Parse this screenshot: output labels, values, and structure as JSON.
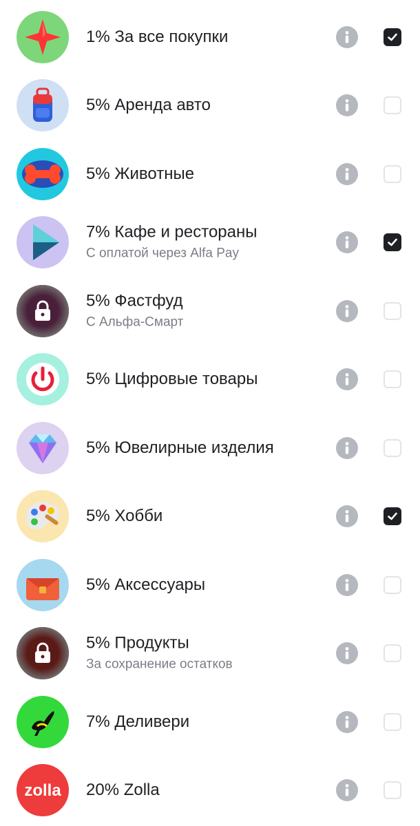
{
  "categories": [
    {
      "title": "1% За все покупки",
      "subtitle": "",
      "checked": true,
      "icon": "red-star-icon",
      "bg": "#7ed67a"
    },
    {
      "title": "5% Аренда авто",
      "subtitle": "",
      "checked": false,
      "icon": "backpack-icon",
      "bg": "#cfe0f5"
    },
    {
      "title": "5% Животные",
      "subtitle": "",
      "checked": false,
      "icon": "bone-icon",
      "bg": "#22c8e0"
    },
    {
      "title": "7% Кафе и рестораны",
      "subtitle": "С оплатой через Alfa Pay",
      "checked": true,
      "icon": "play-icon",
      "bg": "#cdc3f2"
    },
    {
      "title": "5% Фастфуд",
      "subtitle": "С Альфа-Смарт",
      "checked": false,
      "icon": "lock-icon",
      "bg": "#4a1f3a"
    },
    {
      "title": "5% Цифровые товары",
      "subtitle": "",
      "checked": false,
      "icon": "power-icon",
      "bg": "#a6f0e0"
    },
    {
      "title": "5% Ювелирные изделия",
      "subtitle": "",
      "checked": false,
      "icon": "diamond-icon",
      "bg": "#ddd2f0"
    },
    {
      "title": "5% Хобби",
      "subtitle": "",
      "checked": true,
      "icon": "palette-icon",
      "bg": "#fbe6b0"
    },
    {
      "title": "5% Аксессуары",
      "subtitle": "",
      "checked": false,
      "icon": "bag-icon",
      "bg": "#a6d8f0"
    },
    {
      "title": "5% Продукты",
      "subtitle": "За сохранение остатков",
      "checked": false,
      "icon": "lock-icon",
      "bg": "#5a1a16"
    },
    {
      "title": "7% Деливери",
      "subtitle": "",
      "checked": false,
      "icon": "ostrich-icon",
      "bg": "#33d93a"
    },
    {
      "title": "20% Zolla",
      "subtitle": "",
      "checked": false,
      "icon": "zolla-logo-icon",
      "bg": "#ee3b3b",
      "logo_text": "zolla"
    }
  ]
}
